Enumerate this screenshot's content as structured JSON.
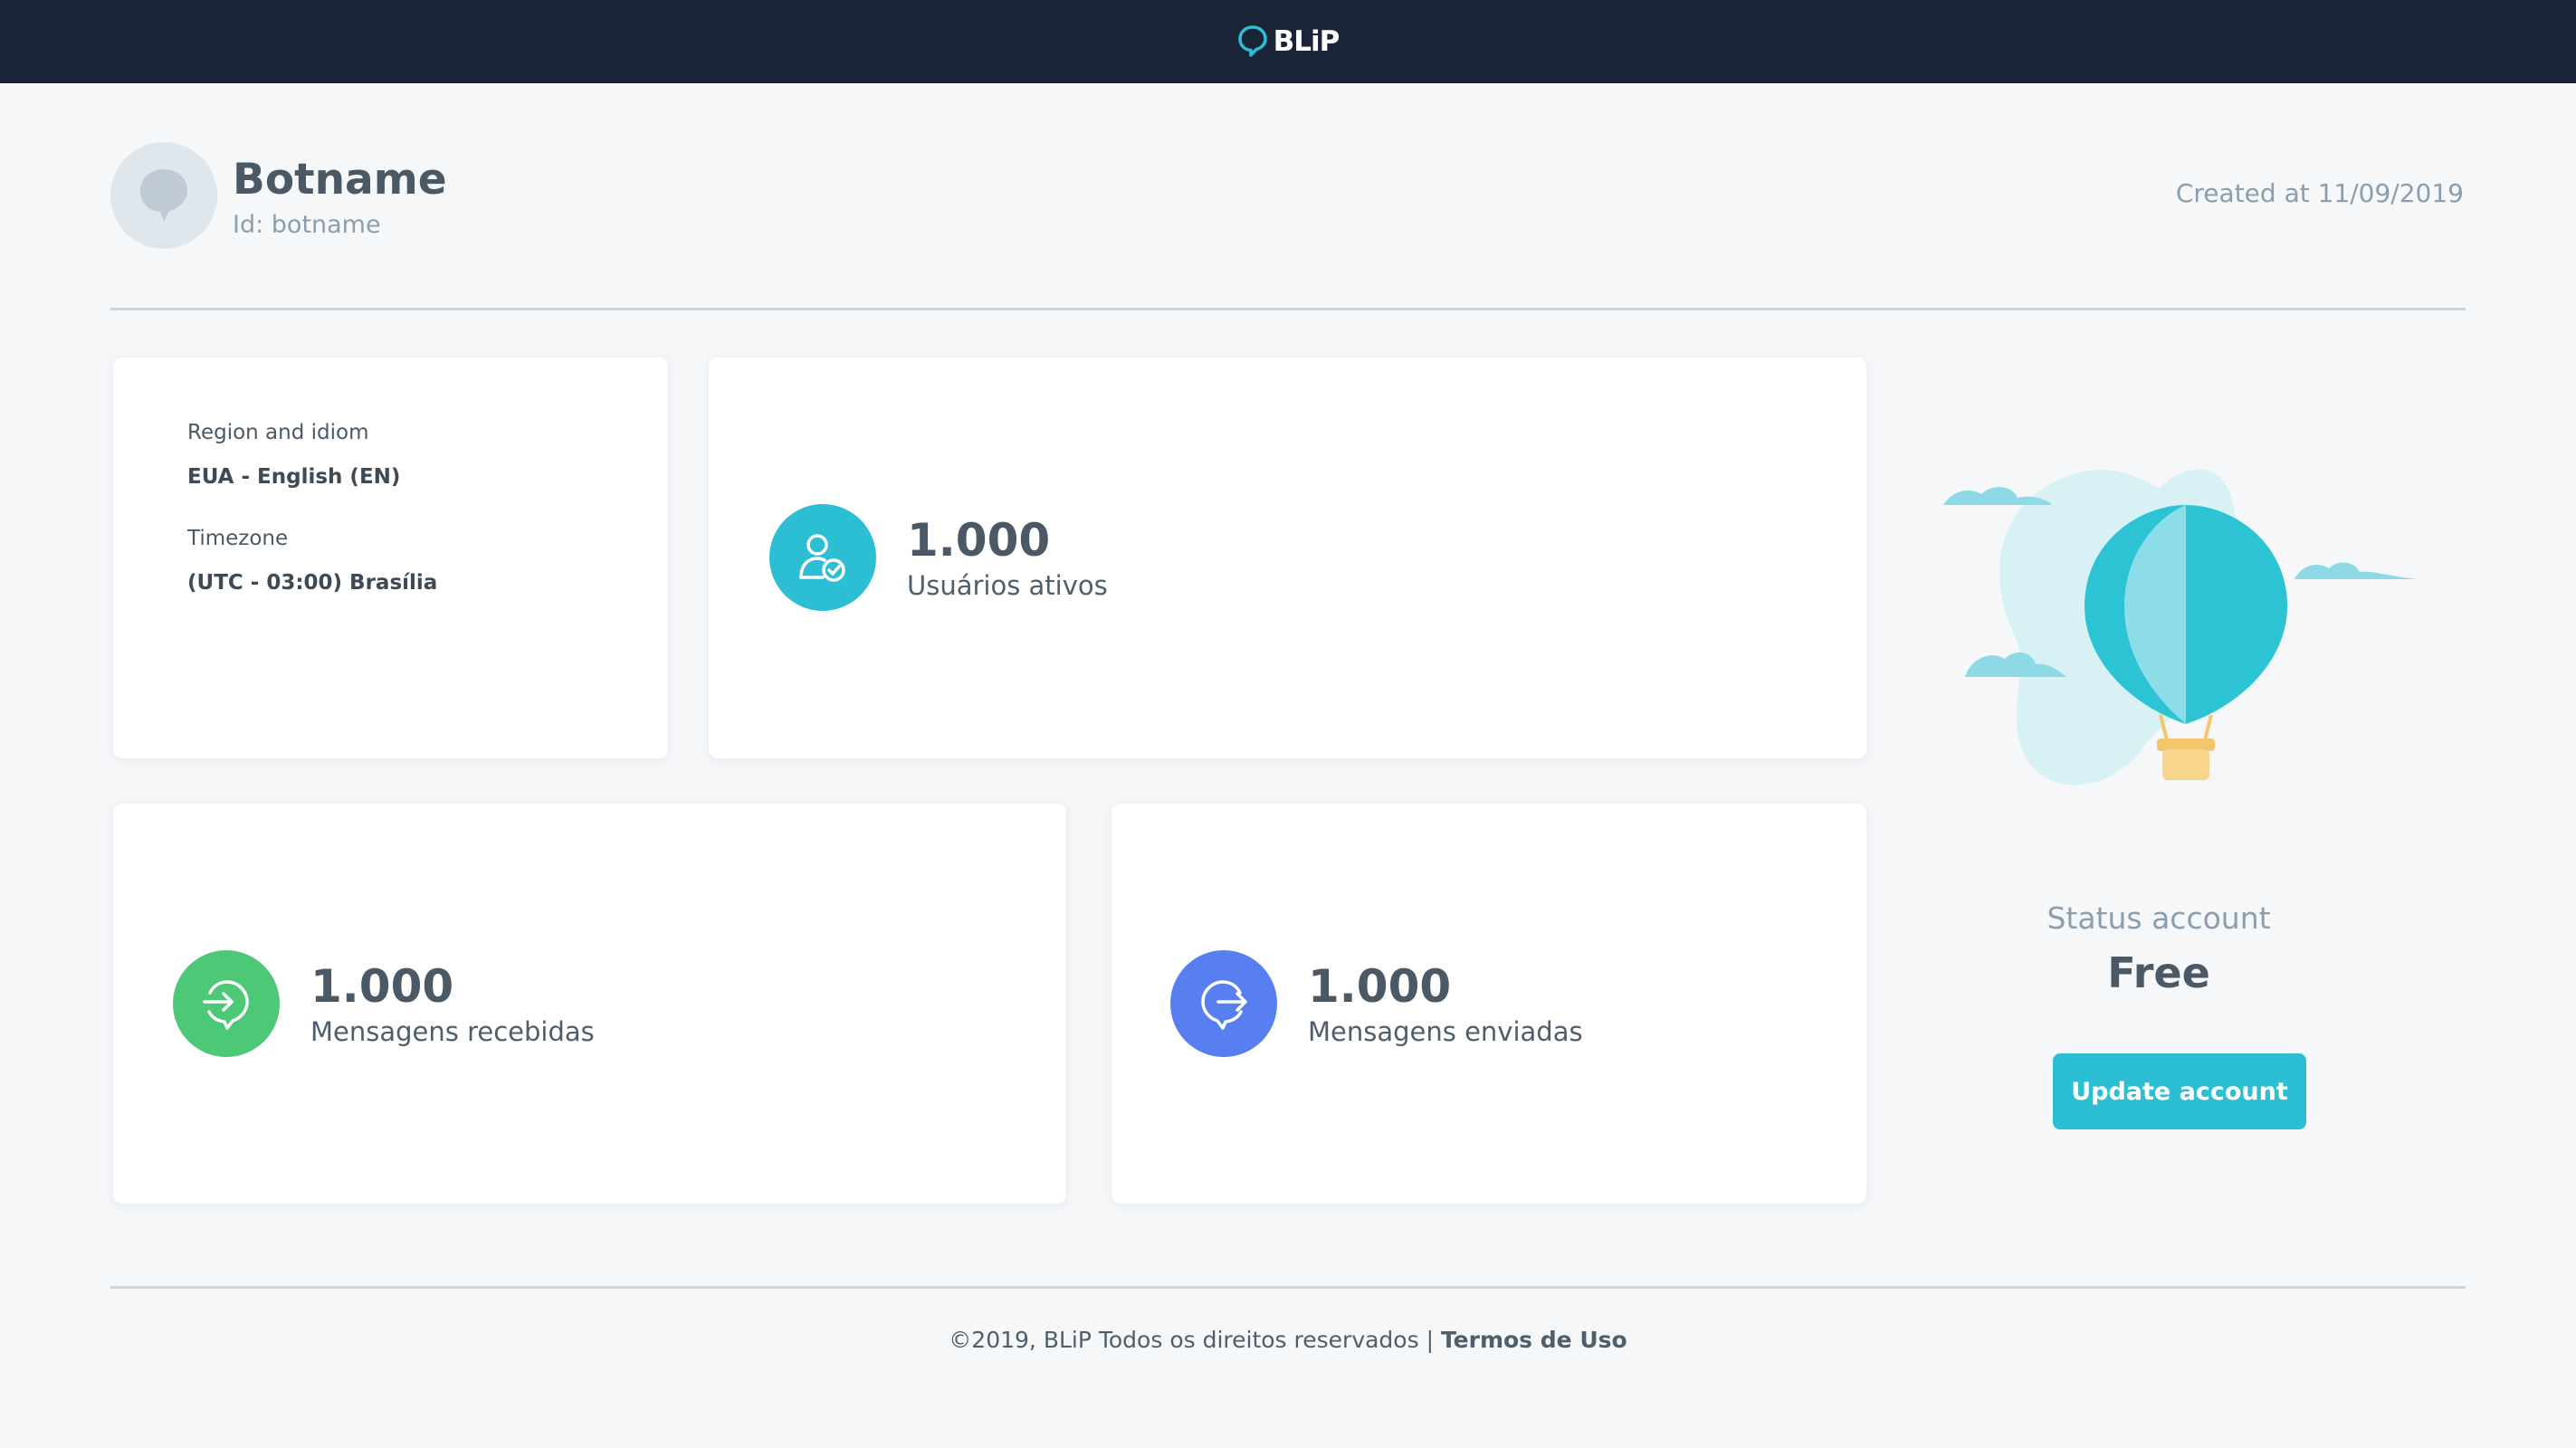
{
  "app": {
    "brand": "BLiP"
  },
  "bot": {
    "name": "Botname",
    "id_text": "Id: botname",
    "created_text": "Created at 11/09/2019"
  },
  "info": {
    "region_label": "Region and idiom",
    "region_value": "EUA - English (EN)",
    "timezone_label": "Timezone",
    "timezone_value": "(UTC - 03:00) Brasília"
  },
  "stats": {
    "active_users": {
      "value": "1.000",
      "label": "Usuários ativos",
      "color": "#2cbfd4"
    },
    "received": {
      "value": "1.000",
      "label": "Mensagens recebidas",
      "color": "#4cc877"
    },
    "sent": {
      "value": "1.000",
      "label": "Mensagens enviadas",
      "color": "#587ff0"
    }
  },
  "account": {
    "status_label": "Status account",
    "status_value": "Free",
    "update_label": "Update account"
  },
  "footer": {
    "copyright": "©2019, BLiP Todos os direitos reservados | ",
    "terms": "Termos de Uso"
  },
  "colors": {
    "topbar": "#1a2437",
    "accent": "#2cbfd4",
    "background": "#f5f7f9"
  }
}
